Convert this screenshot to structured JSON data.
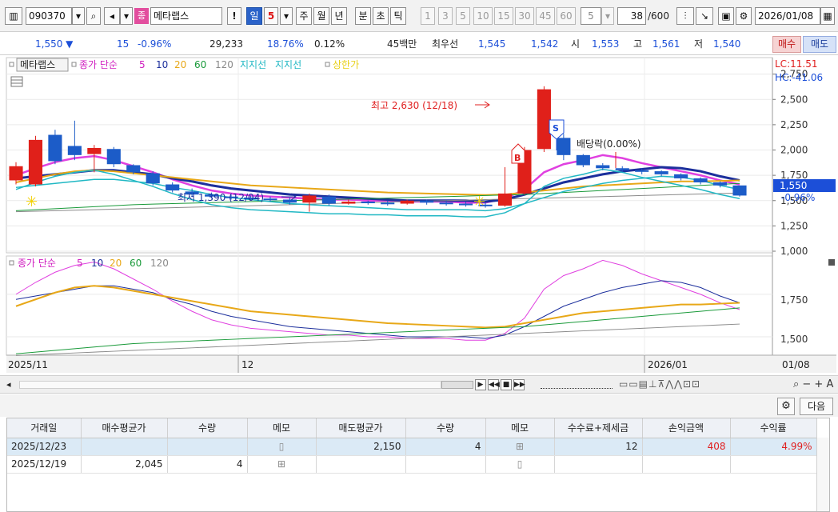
{
  "toolbar": {
    "stock_code": "090370",
    "stock_name": "메타랩스",
    "bang_label": "!",
    "period_tabs": [
      {
        "label": "일",
        "selected": true
      },
      {
        "label": "주",
        "selected": false
      },
      {
        "label": "월",
        "selected": false
      },
      {
        "label": "년",
        "selected": false
      },
      {
        "label": "분",
        "selected": false
      },
      {
        "label": "초",
        "selected": false
      },
      {
        "label": "틱",
        "selected": false
      }
    ],
    "day_unit": "5",
    "interval_buttons": [
      "1",
      "3",
      "5",
      "10",
      "15",
      "30",
      "45",
      "60"
    ],
    "interval_value": "5",
    "count_value": "38",
    "count_max": "/600",
    "date_value": "2026/01/08",
    "icon_names": [
      "chart-layout-icon",
      "search-icon",
      "sound-icon",
      "type-badge-icon",
      "candle-type-icon",
      "draw-line-icon",
      "save-icon",
      "gear-icon",
      "calendar-icon"
    ],
    "type_badge": "종"
  },
  "quote": {
    "price": "1,550",
    "change": "15",
    "change_pct": "-0.96%",
    "volume": "29,233",
    "volume_ratio": "18.76%",
    "turnover": "0.12%",
    "amount": "45백만",
    "best_label": "최우선",
    "best_ask": "1,545",
    "best_bid": "1,542",
    "open_label": "시",
    "open": "1,553",
    "high_label": "고",
    "high": "1,561",
    "low_label": "저",
    "low": "1,540",
    "buy_label": "매수",
    "sell_label": "매도"
  },
  "chart": {
    "legend": {
      "name": "메타랩스",
      "ma_label": "종가 단순",
      "ma_periods": [
        "5",
        "10",
        "20",
        "60",
        "120"
      ],
      "ma_colors": [
        "#e040e0",
        "#1c2f9c",
        "#e8a818",
        "#1a9a3a",
        "#8a8a8a"
      ],
      "support": "지지선",
      "resist": "지지선",
      "limit": "상한가"
    },
    "lc_label": "LC:11.51",
    "hc_label": "HC:-41.06",
    "price_ticks": [
      "2,750",
      "2,500",
      "2,250",
      "2,000",
      "1,750",
      "1,500",
      "1,250",
      "1,000"
    ],
    "current_price": "1,550",
    "current_pct": "-0.96%",
    "max_label": "최고 2,630 (12/18)",
    "min_label": "최저 1,390 (12/04)",
    "dividend_label": "배당락(0.00%)",
    "signal_b": "B",
    "signal_s": "S",
    "lower_legend": {
      "ma_label": "종가 단순",
      "periods": [
        "5",
        "10",
        "20",
        "60",
        "120"
      ]
    },
    "lower_ticks": [
      "1,750",
      "1,500"
    ],
    "x_labels": [
      "2025/11",
      "12",
      "2026/01"
    ],
    "last_date": "01/08"
  },
  "chart_data": {
    "type": "candlestick",
    "title": "",
    "ylim": [
      1000,
      2850
    ],
    "candles": [
      {
        "o": 1700,
        "c": 1840,
        "h": 1880,
        "l": 1660
      },
      {
        "o": 1660,
        "c": 2100,
        "h": 2140,
        "l": 1640
      },
      {
        "o": 2150,
        "c": 1890,
        "h": 2200,
        "l": 1860
      },
      {
        "o": 2040,
        "c": 1950,
        "h": 2290,
        "l": 1900
      },
      {
        "o": 1960,
        "c": 2020,
        "h": 2050,
        "l": 1780
      },
      {
        "o": 2010,
        "c": 1860,
        "h": 2030,
        "l": 1830
      },
      {
        "o": 1850,
        "c": 1780,
        "h": 1860,
        "l": 1760
      },
      {
        "o": 1770,
        "c": 1670,
        "h": 1790,
        "l": 1650
      },
      {
        "o": 1660,
        "c": 1600,
        "h": 1680,
        "l": 1580
      },
      {
        "o": 1590,
        "c": 1560,
        "h": 1620,
        "l": 1540
      },
      {
        "o": 1560,
        "c": 1540,
        "h": 1580,
        "l": 1520
      },
      {
        "o": 1540,
        "c": 1530,
        "h": 1560,
        "l": 1510
      },
      {
        "o": 1530,
        "c": 1520,
        "h": 1550,
        "l": 1500
      },
      {
        "o": 1520,
        "c": 1510,
        "h": 1540,
        "l": 1490
      },
      {
        "o": 1510,
        "c": 1480,
        "h": 1530,
        "l": 1460
      },
      {
        "o": 1480,
        "c": 1550,
        "h": 1570,
        "l": 1390
      },
      {
        "o": 1540,
        "c": 1470,
        "h": 1560,
        "l": 1450
      },
      {
        "o": 1470,
        "c": 1490,
        "h": 1510,
        "l": 1460
      },
      {
        "o": 1490,
        "c": 1480,
        "h": 1500,
        "l": 1460
      },
      {
        "o": 1480,
        "c": 1470,
        "h": 1500,
        "l": 1450
      },
      {
        "o": 1470,
        "c": 1500,
        "h": 1510,
        "l": 1460
      },
      {
        "o": 1500,
        "c": 1480,
        "h": 1510,
        "l": 1460
      },
      {
        "o": 1480,
        "c": 1470,
        "h": 1500,
        "l": 1450
      },
      {
        "o": 1470,
        "c": 1460,
        "h": 1490,
        "l": 1440
      },
      {
        "o": 1460,
        "c": 1450,
        "h": 1480,
        "l": 1430
      },
      {
        "o": 1450,
        "c": 1570,
        "h": 1830,
        "l": 1440
      },
      {
        "o": 1570,
        "c": 2000,
        "h": 2030,
        "l": 1560
      },
      {
        "o": 2010,
        "c": 2600,
        "h": 2630,
        "l": 1980
      },
      {
        "o": 2120,
        "c": 1950,
        "h": 2160,
        "l": 1900
      },
      {
        "o": 1950,
        "c": 1850,
        "h": 1960,
        "l": 1830
      },
      {
        "o": 1850,
        "c": 1820,
        "h": 1870,
        "l": 1800
      },
      {
        "o": 1820,
        "c": 1800,
        "h": 1840,
        "l": 1780
      },
      {
        "o": 1800,
        "c": 1790,
        "h": 1820,
        "l": 1760
      },
      {
        "o": 1790,
        "c": 1760,
        "h": 1800,
        "l": 1740
      },
      {
        "o": 1760,
        "c": 1720,
        "h": 1770,
        "l": 1700
      },
      {
        "o": 1720,
        "c": 1680,
        "h": 1730,
        "l": 1660
      },
      {
        "o": 1680,
        "c": 1650,
        "h": 1690,
        "l": 1630
      },
      {
        "o": 1650,
        "c": 1550,
        "h": 1561,
        "l": 1540
      }
    ],
    "series": [
      {
        "name": "5",
        "color": "#e040e0",
        "values": [
          1750,
          1820,
          1880,
          1920,
          1940,
          1900,
          1840,
          1780,
          1710,
          1650,
          1600,
          1570,
          1550,
          1540,
          1530,
          1520,
          1510,
          1510,
          1500,
          1500,
          1490,
          1490,
          1490,
          1480,
          1480,
          1520,
          1610,
          1780,
          1860,
          1900,
          1950,
          1920,
          1870,
          1830,
          1790,
          1750,
          1700,
          1660
        ]
      },
      {
        "name": "10",
        "color": "#1c2f9c",
        "values": [
          1720,
          1740,
          1760,
          1780,
          1800,
          1800,
          1780,
          1760,
          1720,
          1690,
          1650,
          1620,
          1600,
          1580,
          1560,
          1550,
          1540,
          1530,
          1520,
          1510,
          1500,
          1500,
          1500,
          1500,
          1490,
          1510,
          1560,
          1620,
          1680,
          1720,
          1760,
          1790,
          1810,
          1830,
          1820,
          1790,
          1740,
          1700
        ]
      },
      {
        "name": "20",
        "color": "#e8a818",
        "values": [
          1680,
          1720,
          1760,
          1790,
          1800,
          1790,
          1770,
          1750,
          1730,
          1710,
          1690,
          1670,
          1650,
          1640,
          1630,
          1620,
          1610,
          1600,
          1590,
          1580,
          1575,
          1570,
          1565,
          1560,
          1555,
          1560,
          1580,
          1600,
          1620,
          1640,
          1650,
          1660,
          1670,
          1680,
          1690,
          1690,
          1695,
          1700
        ]
      },
      {
        "name": "60",
        "color": "#1a9a3a",
        "values": [
          1400,
          1410,
          1420,
          1430,
          1440,
          1450,
          1460,
          1465,
          1470,
          1475,
          1480,
          1485,
          1490,
          1495,
          1500,
          1505,
          1510,
          1515,
          1520,
          1525,
          1530,
          1535,
          1540,
          1545,
          1550,
          1555,
          1560,
          1570,
          1580,
          1590,
          1600,
          1610,
          1620,
          1630,
          1640,
          1650,
          1660,
          1670
        ]
      },
      {
        "name": "120",
        "color": "#8a8a8a",
        "values": [
          1390,
          1395,
          1400,
          1405,
          1410,
          1415,
          1420,
          1425,
          1430,
          1435,
          1440,
          1445,
          1450,
          1455,
          1460,
          1465,
          1470,
          1475,
          1480,
          1485,
          1490,
          1495,
          1500,
          1505,
          1510,
          1515,
          1520,
          1525,
          1530,
          1535,
          1540,
          1545,
          1550,
          1555,
          1560,
          1565,
          1570,
          1575
        ]
      }
    ]
  },
  "table": {
    "headers": [
      "거래일",
      "매수평균가",
      "수량",
      "메모",
      "매도평균가",
      "수량",
      "메모",
      "수수료+제세금",
      "손익금액",
      "수익률"
    ],
    "rows": [
      [
        "2025/12/23",
        "",
        "",
        "",
        "2,150",
        "4",
        "",
        "12",
        "408",
        "4.99%"
      ],
      [
        "2025/12/19",
        "2,045",
        "4",
        "",
        "",
        "",
        "",
        "",
        "",
        ""
      ]
    ]
  },
  "buttons": {
    "next_label": "다음"
  }
}
